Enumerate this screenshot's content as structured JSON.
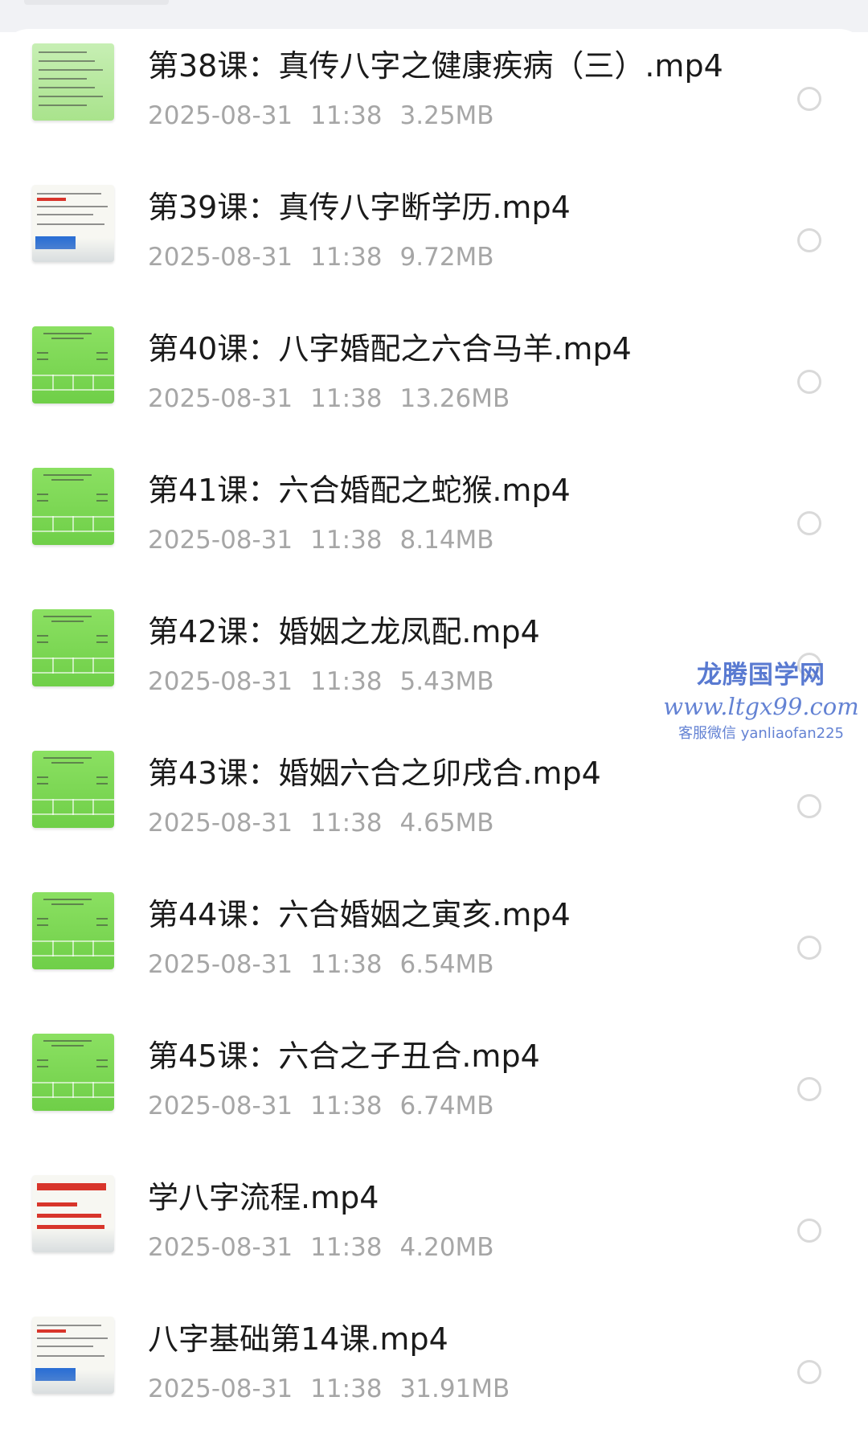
{
  "files": [
    {
      "name": "第38课：真传八字之健康疾病（三）.mp4",
      "date": "2025-08-31",
      "time": "11:38",
      "size": "3.25MB",
      "thumb": "green-text-slide"
    },
    {
      "name": "第39课：真传八字断学历.mp4",
      "date": "2025-08-31",
      "time": "11:38",
      "size": "9.72MB",
      "thumb": "white-text-slide"
    },
    {
      "name": "第40课：八字婚配之六合马羊.mp4",
      "date": "2025-08-31",
      "time": "11:38",
      "size": "13.26MB",
      "thumb": "green-chart-slide"
    },
    {
      "name": "第41课：六合婚配之蛇猴.mp4",
      "date": "2025-08-31",
      "time": "11:38",
      "size": "8.14MB",
      "thumb": "green-chart-slide"
    },
    {
      "name": "第42课：婚姻之龙凤配.mp4",
      "date": "2025-08-31",
      "time": "11:38",
      "size": "5.43MB",
      "thumb": "green-chart-slide"
    },
    {
      "name": "第43课：婚姻六合之卯戌合.mp4",
      "date": "2025-08-31",
      "time": "11:38",
      "size": "4.65MB",
      "thumb": "green-chart-slide"
    },
    {
      "name": "第44课：六合婚姻之寅亥.mp4",
      "date": "2025-08-31",
      "time": "11:38",
      "size": "6.54MB",
      "thumb": "green-chart-slide"
    },
    {
      "name": "第45课：六合之子丑合.mp4",
      "date": "2025-08-31",
      "time": "11:38",
      "size": "6.74MB",
      "thumb": "green-chart-slide"
    },
    {
      "name": "学八字流程.mp4",
      "date": "2025-08-31",
      "time": "11:38",
      "size": "4.20MB",
      "thumb": "white-title-slide"
    },
    {
      "name": "八字基础第14课.mp4",
      "date": "2025-08-31",
      "time": "11:38",
      "size": "31.91MB",
      "thumb": "white-text-slide"
    }
  ],
  "watermark": {
    "title": "龙腾国学网",
    "url": "www.ltgx99.com",
    "contact": "客服微信 yanliaofan225"
  },
  "colors": {
    "name_text": "#1a1a1a",
    "meta_text": "#a6a6a6",
    "radio_border": "#d9d9d9",
    "thumb_green": "#7ed957",
    "watermark": "#3d63c9"
  },
  "icons": {
    "select": "radio-circle-icon",
    "thumbnail": "video-thumbnail-icon"
  }
}
